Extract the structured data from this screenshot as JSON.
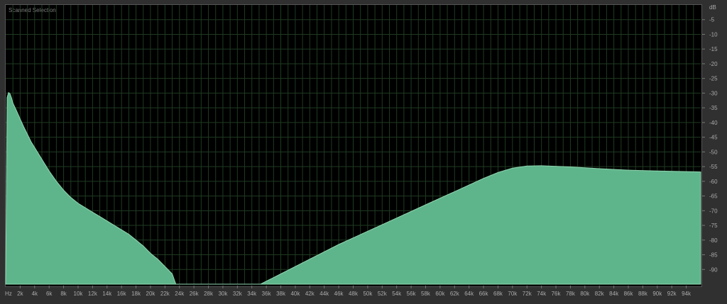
{
  "panel": {
    "title": "Scanned Selection"
  },
  "colors": {
    "fill": "#5fb58b",
    "stroke": "#8fd6b0",
    "grid": "#1f3b22",
    "background": "#000000"
  },
  "chart_data": {
    "type": "area",
    "title": "Scanned Selection",
    "xlabel": "Hz",
    "ylabel": "dB",
    "xlim": [
      0,
      96000
    ],
    "ylim": [
      -95,
      0
    ],
    "grid": true,
    "x_ticks": [
      "2k",
      "4k",
      "6k",
      "8k",
      "10k",
      "12k",
      "14k",
      "16k",
      "18k",
      "20k",
      "22k",
      "24k",
      "26k",
      "28k",
      "30k",
      "32k",
      "34k",
      "36k",
      "38k",
      "40k",
      "42k",
      "44k",
      "46k",
      "48k",
      "50k",
      "52k",
      "54k",
      "56k",
      "58k",
      "60k",
      "62k",
      "64k",
      "66k",
      "68k",
      "70k",
      "72k",
      "74k",
      "76k",
      "78k",
      "80k",
      "82k",
      "84k",
      "86k",
      "88k",
      "90k",
      "92k",
      "94k"
    ],
    "y_ticks": [
      "-5",
      "-10",
      "-15",
      "-20",
      "-25",
      "-30",
      "-35",
      "-40",
      "-45",
      "-50",
      "-55",
      "-60",
      "-65",
      "-70",
      "-75",
      "-80",
      "-85",
      "-90"
    ],
    "series": [
      {
        "points": [
          [
            0,
            -95
          ],
          [
            200,
            -31.5
          ],
          [
            400,
            -29.8
          ],
          [
            600,
            -30.2
          ],
          [
            800,
            -31.6
          ],
          [
            1000,
            -33.4
          ],
          [
            1500,
            -36
          ],
          [
            2000,
            -38.8
          ],
          [
            2500,
            -41.5
          ],
          [
            3000,
            -44
          ],
          [
            3500,
            -46.5
          ],
          [
            4000,
            -48.5
          ],
          [
            5000,
            -52.5
          ],
          [
            6000,
            -56.5
          ],
          [
            7000,
            -60
          ],
          [
            8000,
            -63
          ],
          [
            9000,
            -65.5
          ],
          [
            10000,
            -67.5
          ],
          [
            11000,
            -69
          ],
          [
            12000,
            -70.5
          ],
          [
            13000,
            -72
          ],
          [
            14000,
            -73.5
          ],
          [
            15000,
            -75
          ],
          [
            16000,
            -76.5
          ],
          [
            17000,
            -78
          ],
          [
            18000,
            -80
          ],
          [
            19000,
            -82
          ],
          [
            20000,
            -84.5
          ],
          [
            21000,
            -86.5
          ],
          [
            22000,
            -89
          ],
          [
            23000,
            -91.5
          ],
          [
            23500,
            -95
          ],
          [
            35200,
            -95
          ],
          [
            38000,
            -91.5
          ],
          [
            42000,
            -86.5
          ],
          [
            46000,
            -81.5
          ],
          [
            50000,
            -77
          ],
          [
            54000,
            -72.5
          ],
          [
            58000,
            -68
          ],
          [
            62000,
            -63.5
          ],
          [
            66000,
            -59
          ],
          [
            68000,
            -57
          ],
          [
            70000,
            -55.5
          ],
          [
            72000,
            -54.8
          ],
          [
            74000,
            -54.7
          ],
          [
            78000,
            -55.1
          ],
          [
            82000,
            -55.7
          ],
          [
            86000,
            -56.2
          ],
          [
            90000,
            -56.5
          ],
          [
            96000,
            -56.8
          ],
          [
            96000,
            -95
          ]
        ]
      }
    ]
  }
}
